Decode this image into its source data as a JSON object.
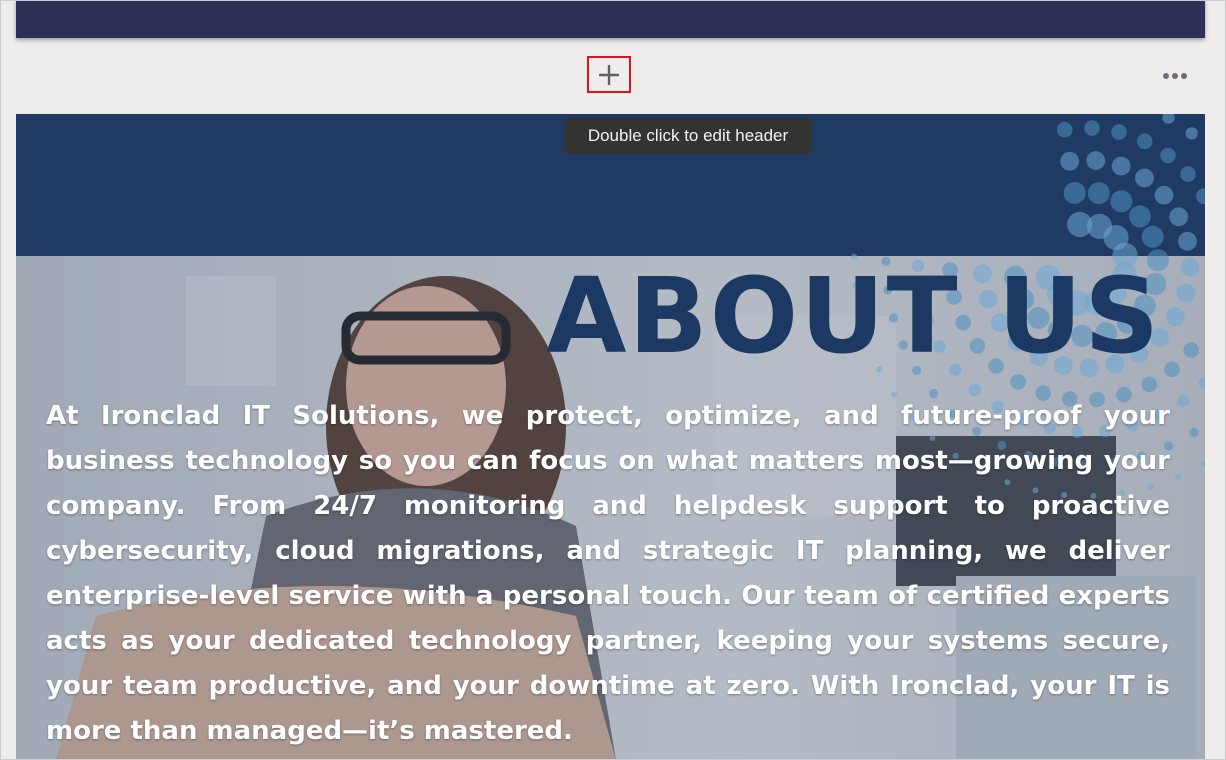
{
  "editor": {
    "add_section_icon": "plus-icon",
    "more_icon": "more-horizontal-icon",
    "tooltip": "Double click to edit header"
  },
  "header": {
    "title": "ABOUT US",
    "body": "At Ironclad IT Solutions, we protect, optimize, and future-proof your business technology so you can focus on what matters most—growing your company. From 24/7 monitoring and helpdesk support to proactive cybersecurity, cloud migrations, and strategic IT planning, we deliver enterprise-level service with a personal touch. Our team of certified experts acts as your dedicated technology partner, keeping your systems secure, your team productive, and your downtime at zero. With Ironclad, your IT is more than managed—it’s mastered."
  },
  "colors": {
    "top_section": "#2e3058",
    "header_band": "#1f3b63",
    "title": "#1c3964",
    "highlight": "#e0141b",
    "tooltip_bg": "#333333"
  }
}
